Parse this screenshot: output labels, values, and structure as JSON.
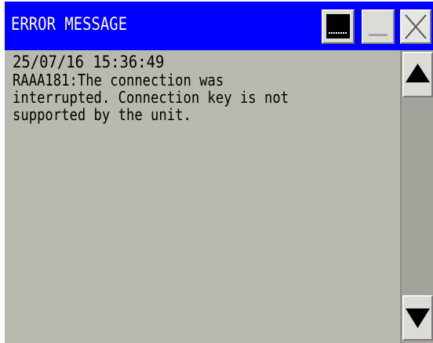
{
  "window": {
    "title": "ERROR MESSAGE"
  },
  "titlebar_buttons": {
    "console": "console-icon",
    "minimize": "minimize-icon",
    "close": "close-icon"
  },
  "error_log": {
    "timestamp": "25/07/16 15:36:49",
    "message": "RAAA181:The connection was\ninterrupted. Connection key is not\nsupported by the unit."
  },
  "scrollbar": {
    "up_icon": "triangle-up-icon",
    "down_icon": "triangle-down-icon"
  },
  "colors": {
    "titlebar": "#0000ff",
    "title_text": "#ffffff",
    "window_bg": "#b9b9b0",
    "scroll_track": "#a3a39b"
  }
}
